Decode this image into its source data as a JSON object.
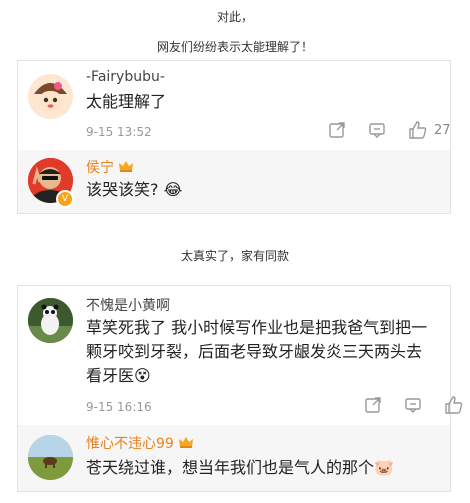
{
  "captions": {
    "first": "对此，",
    "second": "网友们纷纷表示太能理解了！",
    "third": "太真实了，家有同款"
  },
  "comment1": {
    "username": "-Fairybubu-",
    "text": "太能理解了",
    "time": "9-15 13:52",
    "like_count": "27",
    "reply": {
      "username": "侯宁",
      "text": "该哭该笑?",
      "emoji": "😂"
    }
  },
  "comment2": {
    "username": "不愧是小黄啊",
    "lines": [
      "草笑死我了 我小时候写作业也是把我爸气到把一",
      "颗牙咬到牙裂，后面老导致牙龈发炎三天两头去",
      "看牙医"
    ],
    "emoji": "😵",
    "time": "9-15 16:16",
    "reply": {
      "username": "惟心不违心99",
      "text": "苍天绕过谁，想当年我们也是气人的那个",
      "emoji": "🐷"
    }
  },
  "icons": {
    "share": "share-icon",
    "comment": "comment-icon",
    "like": "thumbs-up-icon",
    "crown": "crown-badge-icon",
    "verified": "verified-badge-icon"
  },
  "colors": {
    "gold_name": "#e8821c",
    "reply_bg": "#f6f6f6",
    "meta": "#999999"
  }
}
